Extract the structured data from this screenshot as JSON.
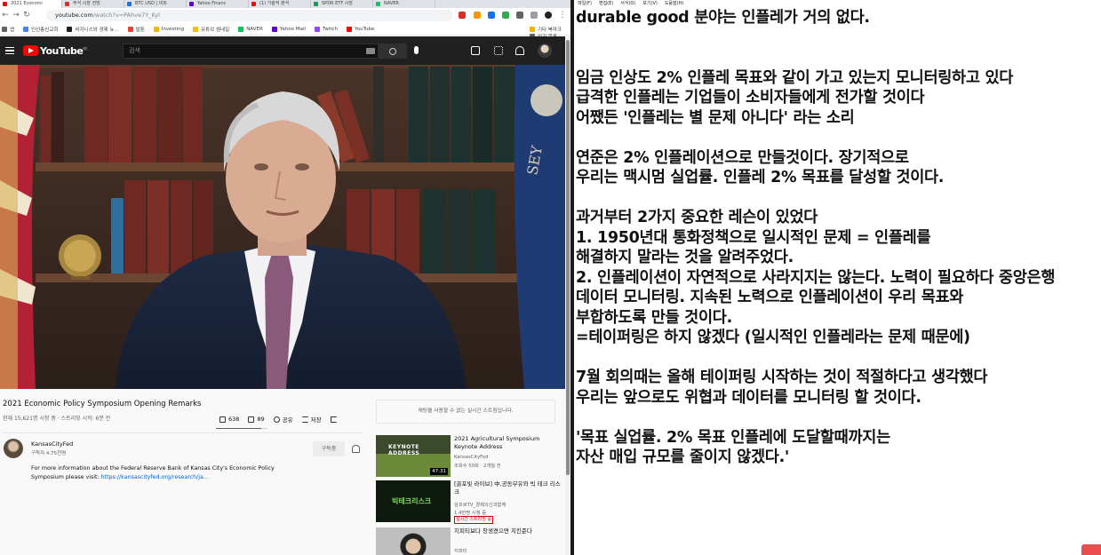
{
  "browser": {
    "tabs": [
      {
        "label": "2021 Economi",
        "color": "#ff0000",
        "active": true
      },
      {
        "label": "주식 시장 전망",
        "color": "#d93025",
        "active": false
      },
      {
        "label": "BTC USD | 비트",
        "color": "#1a73e8",
        "active": false
      },
      {
        "label": "Yahoo Financ",
        "color": "#6001d2",
        "active": false
      },
      {
        "label": "(1) 기술적 분석",
        "color": "#ff0000",
        "active": false
      },
      {
        "label": "SPDR ETF 시장",
        "color": "#0f9d58",
        "active": false
      },
      {
        "label": "NAVER",
        "color": "#03c75a",
        "active": false
      }
    ],
    "url_host": "youtube.com",
    "url_rest": "/watch?v=PAhve7Y_Kyl",
    "bookmarks": [
      {
        "label": "앱",
        "color": "#5f6368"
      },
      {
        "label": "인선총신교회",
        "color": "#4285f4"
      },
      {
        "label": "비지니스와 경제 뉴...",
        "color": "#202124"
      },
      {
        "label": "발툰",
        "color": "#ea4335"
      },
      {
        "label": "Investing",
        "color": "#f4b400"
      },
      {
        "label": "유튜브 썸네일",
        "color": "#fbbc04"
      },
      {
        "label": "NAVER",
        "color": "#03c75a"
      },
      {
        "label": "Yahoo Mail",
        "color": "#6001d2"
      },
      {
        "label": "Twitch",
        "color": "#9146ff"
      },
      {
        "label": "YouTube",
        "color": "#ff0000"
      }
    ],
    "bookmarks_other": [
      {
        "label": "기타 북마크",
        "color": "#f4b400"
      },
      {
        "label": "읽기 목록",
        "color": "#5f6368"
      }
    ]
  },
  "youtube": {
    "logo_text": "YouTube",
    "logo_sup": "KR",
    "search_placeholder": "검색",
    "video": {
      "title": "2021 Economic Policy Symposium Opening Remarks",
      "meta": "현재 15,621명 시청 중 · 스트리밍 시작: 6분 전",
      "likes": "638",
      "dislikes": "89",
      "share": "공유",
      "save": "저장",
      "like_ratio": 0.88
    },
    "channel": {
      "name": "KansasCityFed",
      "subs": "구독자 4.75천명",
      "subscribe": "구독중"
    },
    "description_text": "For more information about the Federal Reserve Bank of Kansas City's Economic Policy Symposium please visit: ",
    "description_link": "https://kansascityfed.org/research/ja...",
    "chat_notice": "채팅을 사용할 수 없는 실시간 스트림입니다.",
    "recommendations": [
      {
        "title": "2021 Agricultural Symposium Keynote Address",
        "channel": "KansasCityFed",
        "meta": "조회수 50회 · 2개월 전",
        "duration": "47:31",
        "thumb_text": "KEYNOTE ADDRESS"
      },
      {
        "title": "[골포빛 라이브] 中,공동부유와 빅 테크 리스크",
        "channel": "삼프로TV_경제의신과함께",
        "meta": "1.4만명 시청 중",
        "badge": "실시간 스트리밍 중",
        "thumb_text": "빅테크리스크"
      },
      {
        "title": "지피티보다 창생겼으면 치킨준다",
        "channel": "지피티",
        "meta": ""
      }
    ]
  },
  "notepad": {
    "menu": [
      "파일(F)",
      "편집(E)",
      "서식(O)",
      "보기(V)",
      "도움말(H)"
    ],
    "lines": [
      "durable good 분야는 인플레가 거의 없다.",
      "",
      "",
      "임금 인상도 2% 인플레 목표와 같이 가고 있는지 모니터링하고 있다",
      "급격한 인플레는 기업들이 소비자들에게 전가할 것이다",
      "어쨌든 '인플레는 별 문제 아니다' 라는 소리",
      "",
      "연준은 2% 인플레이션으로 만들것이다. 장기적으로",
      "우리는 맥시멈 실업률. 인플레 2% 목표를 달성할 것이다.",
      "",
      "과거부터 2가지 중요한 레슨이 있었다",
      "1. 1950년대 통화정책으로 일시적인 문제 = 인플레를",
      "해결하지 말라는 것을 알려주었다.",
      "2. 인플레이션이 자연적으로 사라지지는 않는다. 노력이 필요하다 중앙은행",
      "데이터 모니터링. 지속된 노력으로 인플레이션이 우리 목표와",
      "부합하도록 만들 것이다.",
      "=테이퍼링은 하지 않겠다 (일시적인 인플레라는 문제 때문에)",
      "",
      "7월 회의때는 올해 테이퍼링 시작하는 것이 적절하다고 생각했다",
      "우리는 앞으로도 위협과 데이터를 모니터링 할 것이다.",
      "",
      "'목표 실업률. 2% 목표 인플레에 도달할때까지는",
      "자산 매입 규모를 줄이지 않겠다.'"
    ]
  }
}
